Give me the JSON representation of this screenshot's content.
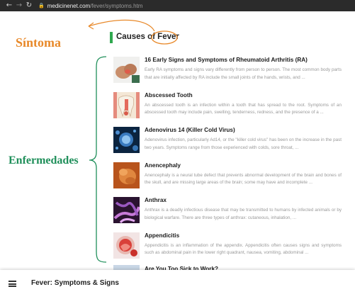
{
  "browser": {
    "back_icon": "arrow-left",
    "forward_icon": "arrow-right",
    "reload_icon": "reload",
    "lock_icon": "lock",
    "url_host": "medicinenet.com",
    "url_path": "/fever/symptoms.htm"
  },
  "annotations": {
    "sintoma": "Síntoma",
    "enfermedades": "Enfermedades",
    "sintoma_color": "#e8892a",
    "enfermedades_color": "#1f8f5a"
  },
  "heading": {
    "prefix": "Causes of ",
    "keyword": "Fever",
    "accent_color": "#2fa84f"
  },
  "items": [
    {
      "title": "16 Early Signs and Symptoms of Rheumatoid Arthritis (RA)",
      "desc": "Early RA symptoms and signs vary differently from person to person. The most common body parts that are initially affected by RA include the small joints of the hands, wrists, and ..."
    },
    {
      "title": "Abscessed Tooth",
      "desc": "An abscessed tooth is an infection within a tooth that has spread to the root. Symptoms of an abscessed tooth may include pain, swelling, tenderness, redness, and the presence of a ..."
    },
    {
      "title": "Adenovirus 14 (Killer Cold Virus)",
      "desc": "Adenovirus infection, particularly Ad14, or the \"killer cold virus\" has been on the increase in the past two years. Symptoms range from those experienced with colds, sore throat, ..."
    },
    {
      "title": "Anencephaly",
      "desc": "Anencephaly is a neural tube defect that prevents abnormal development of the brain and bones of the skull, and are missing large areas of the brain; some may have and incomplete ..."
    },
    {
      "title": "Anthrax",
      "desc": "Anthrax is a deadly infectious disease that may be transmitted to humans by infected animals or by biological warfare. There are three types of anthrax: cutaneous, inhalation, ..."
    },
    {
      "title": "Appendicitis",
      "desc": "Appendicitis is an inflammation of the appendix. Appendicitis often causes signs and symptoms such as abdominal pain in the lower right quadrant, nausea, vomiting, abdominal ..."
    }
  ],
  "partial_item": {
    "title": "Are You Too Sick to Work?"
  },
  "bottom_bar": {
    "menu_icon": "hamburger",
    "title": "Fever: Symptoms & Signs"
  }
}
